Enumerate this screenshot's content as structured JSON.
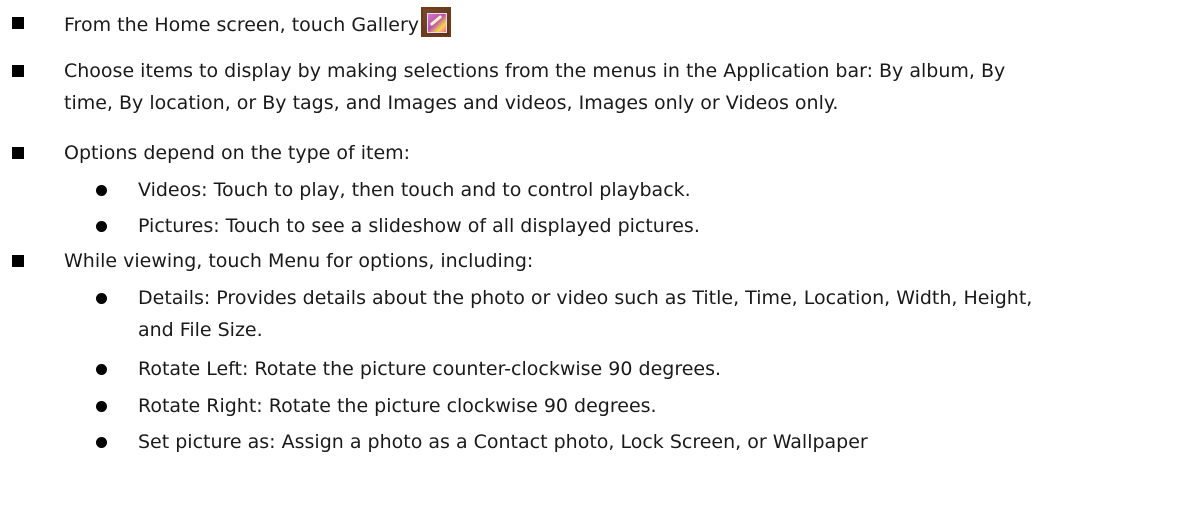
{
  "items": [
    {
      "level": 1,
      "text": "From the Home screen, touch Gallery",
      "icon": "gallery-icon"
    },
    {
      "level": 1,
      "lines": [
        "Choose items to display by making selections from the menus in the Application bar: By album, By",
        "time, By location, or By tags, and Images and videos, Images only or Videos only."
      ]
    },
    {
      "level": 1,
      "text": "Options depend on the type of item:"
    },
    {
      "level": 2,
      "text": "Videos: Touch to play, then touch and to control playback."
    },
    {
      "level": 2,
      "text": "Pictures: Touch to see a slideshow of all displayed pictures."
    },
    {
      "level": 1,
      "text": "While viewing, touch Menu for options, including:"
    },
    {
      "level": 2,
      "lines": [
        "Details: Provides details about the photo or video such as Title, Time, Location, Width, Height,",
        "and File Size."
      ]
    },
    {
      "level": 2,
      "text": "Rotate Left: Rotate the picture counter-clockwise 90 degrees."
    },
    {
      "level": 2,
      "text": "Rotate Right: Rotate the picture clockwise 90 degrees."
    },
    {
      "level": 2,
      "text": "Set picture as: Assign a photo as a Contact photo, Lock Screen, or Wallpaper"
    }
  ]
}
